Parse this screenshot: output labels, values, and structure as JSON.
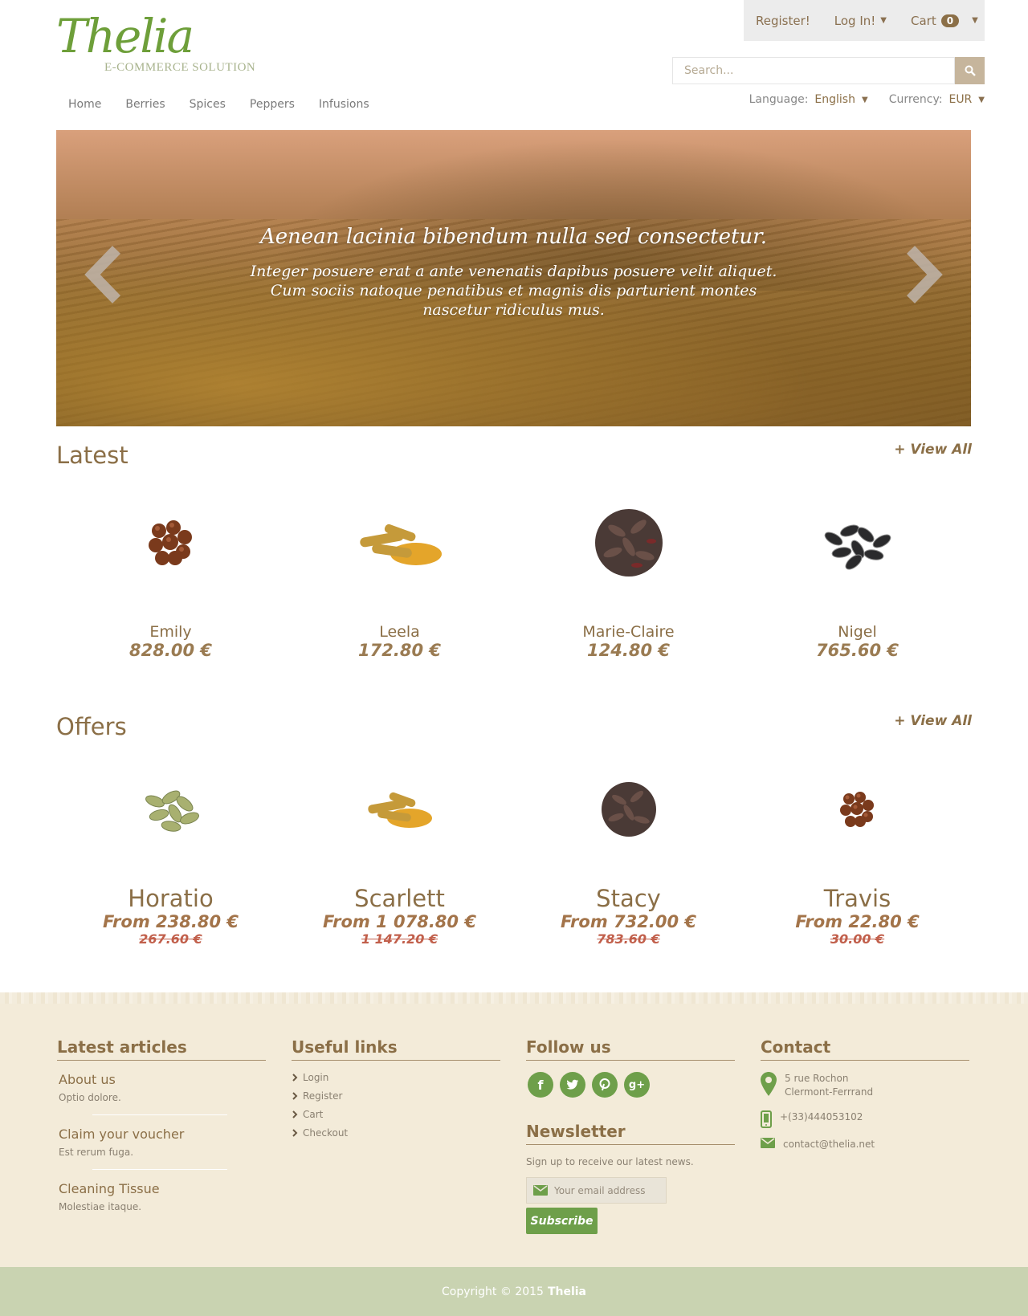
{
  "logo": {
    "script": "Thelia",
    "sub": "E-COMMERCE SOLUTION"
  },
  "account": {
    "register": "Register!",
    "login": "Log In!",
    "cart": "Cart",
    "cart_count": "0"
  },
  "search": {
    "placeholder": "Search..."
  },
  "nav": [
    "Home",
    "Berries",
    "Spices",
    "Peppers",
    "Infusions"
  ],
  "prefs": {
    "language_label": "Language:",
    "language_value": "English",
    "currency_label": "Currency:",
    "currency_value": "EUR"
  },
  "hero": {
    "title": "Aenean lacinia bibendum nulla sed consectetur.",
    "desc": "Integer posuere erat a ante venenatis dapibus posuere velit aliquet. Cum sociis natoque penatibus et magnis dis parturient montes nascetur ridiculus mus."
  },
  "latest": {
    "title": "Latest",
    "view_all": "+ View All",
    "products": [
      {
        "name": "Emily",
        "price": "828.00 €"
      },
      {
        "name": "Leela",
        "price": "172.80 €"
      },
      {
        "name": "Marie-Claire",
        "price": "124.80 €"
      },
      {
        "name": "Nigel",
        "price": "765.60 €"
      }
    ]
  },
  "offers": {
    "title": "Offers",
    "view_all": "+ View All",
    "products": [
      {
        "name": "Horatio",
        "price": "From 238.80 €",
        "old": "267.60 €"
      },
      {
        "name": "Scarlett",
        "price": "From 1 078.80 €",
        "old": "1 147.20 €"
      },
      {
        "name": "Stacy",
        "price": "From 732.00 €",
        "old": "783.60 €"
      },
      {
        "name": "Travis",
        "price": "From 22.80 €",
        "old": "30.00 €"
      }
    ]
  },
  "footer": {
    "articles_title": "Latest articles",
    "articles": [
      {
        "title": "About us",
        "summary": "Optio dolore."
      },
      {
        "title": "Claim your voucher",
        "summary": "Est rerum fuga."
      },
      {
        "title": "Cleaning Tissue",
        "summary": "Molestiae itaque."
      }
    ],
    "links_title": "Useful links",
    "links": [
      "Login",
      "Register",
      "Cart",
      "Checkout"
    ],
    "follow_title": "Follow us",
    "newsletter_title": "Newsletter",
    "newsletter_desc": "Sign up to receive our latest news.",
    "email_placeholder": "Your email address",
    "subscribe": "Subscribe",
    "contact_title": "Contact",
    "address1": "5 rue Rochon",
    "address2": "Clermont-Ferrrand",
    "phone": "+(33)444053102",
    "email": "contact@thelia.net"
  },
  "copyright": {
    "text": "Copyright © 2015",
    "brand": "Thelia"
  },
  "colors": {
    "brown": "#8b6f47",
    "green": "#6e9f4a",
    "footer_bg": "#f3ebd9",
    "bottom_bg": "#c9d3b1"
  }
}
